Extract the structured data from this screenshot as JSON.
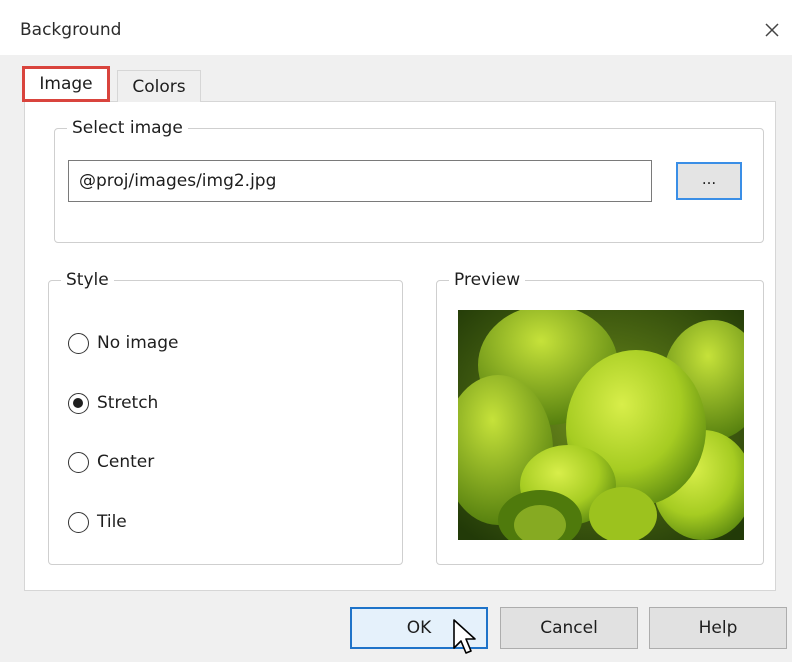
{
  "window": {
    "title": "Background",
    "close_icon": "close-icon"
  },
  "tabs": [
    {
      "label": "Image",
      "active": true
    },
    {
      "label": "Colors",
      "active": false
    }
  ],
  "select_image": {
    "legend": "Select image",
    "path_value": "@proj/images/img2.jpg",
    "browse_label": "..."
  },
  "style": {
    "legend": "Style",
    "options": [
      {
        "label": "No image",
        "selected": false
      },
      {
        "label": "Stretch",
        "selected": true
      },
      {
        "label": "Center",
        "selected": false
      },
      {
        "label": "Tile",
        "selected": false
      }
    ]
  },
  "preview": {
    "legend": "Preview",
    "image": "green-succulent-photo"
  },
  "buttons": {
    "ok": "OK",
    "cancel": "Cancel",
    "help": "Help"
  },
  "colors": {
    "highlight": "#d9443d",
    "focus": "#1e73c9",
    "accent": "#3a8ee6"
  }
}
